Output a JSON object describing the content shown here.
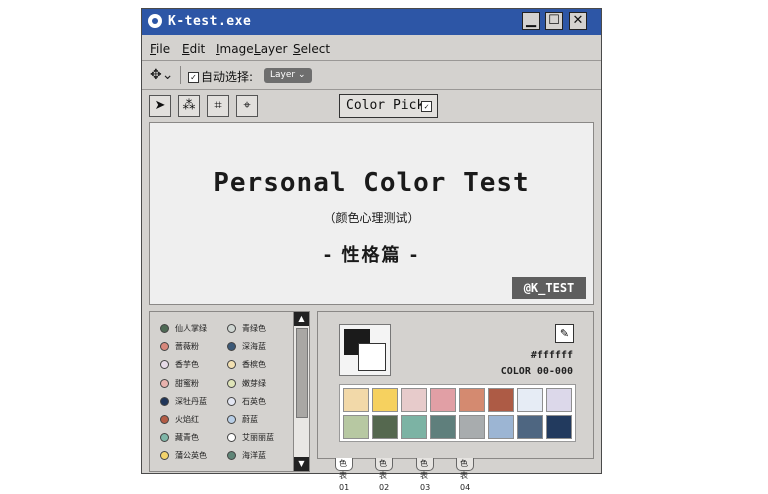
{
  "window": {
    "title": "K-test.exe",
    "controls": {
      "minimize": "▁",
      "maximize": "☐",
      "close": "✕"
    }
  },
  "menu": [
    {
      "key": "F",
      "rest": "ile"
    },
    {
      "key": "E",
      "rest": "dit"
    },
    {
      "key": "I",
      "rest": "mage"
    },
    {
      "key": "L",
      "rest": "ayer"
    },
    {
      "key": "S",
      "rest": "elect"
    }
  ],
  "options": {
    "move_glyph": "✥⌄",
    "auto_select_label": "自动选择:",
    "auto_select_checked": "✓",
    "layer_value": "Layer ⌄"
  },
  "tools": {
    "pointer": "➤",
    "magic_wand": "⁂",
    "crop": "⌗",
    "target": "⌖",
    "color_pick_label": "Color Pick",
    "color_pick_checked": "✓"
  },
  "canvas": {
    "title": "Personal Color Test",
    "subtitle": "（颜色心理测试）",
    "heading": "- 性格篇 -",
    "badge": "@K_TEST"
  },
  "color_list": [
    {
      "label": "仙人掌绿",
      "color": "#4e6a55"
    },
    {
      "label": "青绿色",
      "color": "#cfd6d2"
    },
    {
      "label": "蔷薇粉",
      "color": "#d8887c"
    },
    {
      "label": "深海蓝",
      "color": "#3d5a78"
    },
    {
      "label": "香芋色",
      "color": "#e6dbe7"
    },
    {
      "label": "香槟色",
      "color": "#f2e0b2"
    },
    {
      "label": "甜蜜粉",
      "color": "#e8b2ad"
    },
    {
      "label": "嫩芽绿",
      "color": "#dfe4b8"
    },
    {
      "label": "深牡丹蓝",
      "color": "#1f3559"
    },
    {
      "label": "石英色",
      "color": "#e3e6f2"
    },
    {
      "label": "火焰红",
      "color": "#b35c45"
    },
    {
      "label": "蔚蓝",
      "color": "#b8cee6"
    },
    {
      "label": "藏青色",
      "color": "#7fb6a8"
    },
    {
      "label": "艾丽丽蓝",
      "color": "#ffffff"
    },
    {
      "label": "蒲公英色",
      "color": "#f3d36b"
    },
    {
      "label": "海洋蓝",
      "color": "#5f8577"
    }
  ],
  "scroll": {
    "up": "▲",
    "down": "▼"
  },
  "palette": {
    "hex": "#ffffff",
    "code": "COLOR 00-000",
    "eyedropper": "✎",
    "swatches": [
      "#f2d9a9",
      "#f6d15f",
      "#e7cbcb",
      "#e19fa5",
      "#d48a70",
      "#ad5b45",
      "#e6ecf5",
      "#dcd8ea",
      "#b7c8a2",
      "#55684f",
      "#7cb3a4",
      "#5f7f7c",
      "#a8acae",
      "#9cb5d3",
      "#4e6681",
      "#223a5e"
    ],
    "tabs": [
      "色表01",
      "色表02",
      "色表03",
      "色表04"
    ]
  }
}
